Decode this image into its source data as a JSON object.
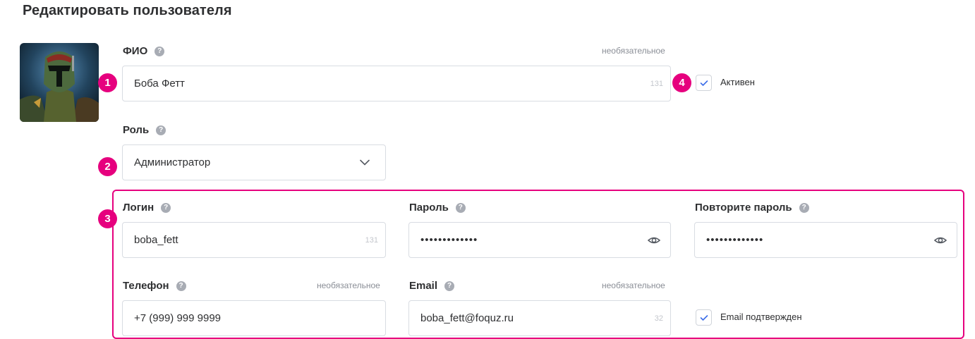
{
  "page": {
    "title": "Редактировать пользователя"
  },
  "fio": {
    "label": "ФИО",
    "help": "?",
    "optional": "необязательное",
    "value": "Боба Фетт",
    "counter": "131"
  },
  "active": {
    "label": "Активен",
    "checked": true
  },
  "role": {
    "label": "Роль",
    "help": "?",
    "value": "Администратор"
  },
  "login": {
    "label": "Логин",
    "help": "?",
    "value": "boba_fett",
    "counter": "131"
  },
  "password": {
    "label": "Пароль",
    "help": "?",
    "value": "•••••••••••••"
  },
  "password_repeat": {
    "label": "Повторите пароль",
    "help": "?",
    "value": "•••••••••••••"
  },
  "phone": {
    "label": "Телефон",
    "help": "?",
    "optional": "необязательное",
    "value": "+7 (999) 999 9999"
  },
  "email": {
    "label": "Email",
    "help": "?",
    "optional": "необязательное",
    "value": "boba_fett@foquz.ru",
    "counter": "32"
  },
  "email_confirmed": {
    "label": "Email подтвержден",
    "checked": true
  },
  "annotations": {
    "b1": "1",
    "b2": "2",
    "b3": "3",
    "b4": "4"
  },
  "colors": {
    "accent": "#e6007e",
    "check": "#3d6ee8",
    "border": "#d8dce2"
  },
  "icons": {
    "help": "question-icon",
    "eye": "eye-icon",
    "chevron": "chevron-down-icon",
    "check": "check-icon"
  }
}
